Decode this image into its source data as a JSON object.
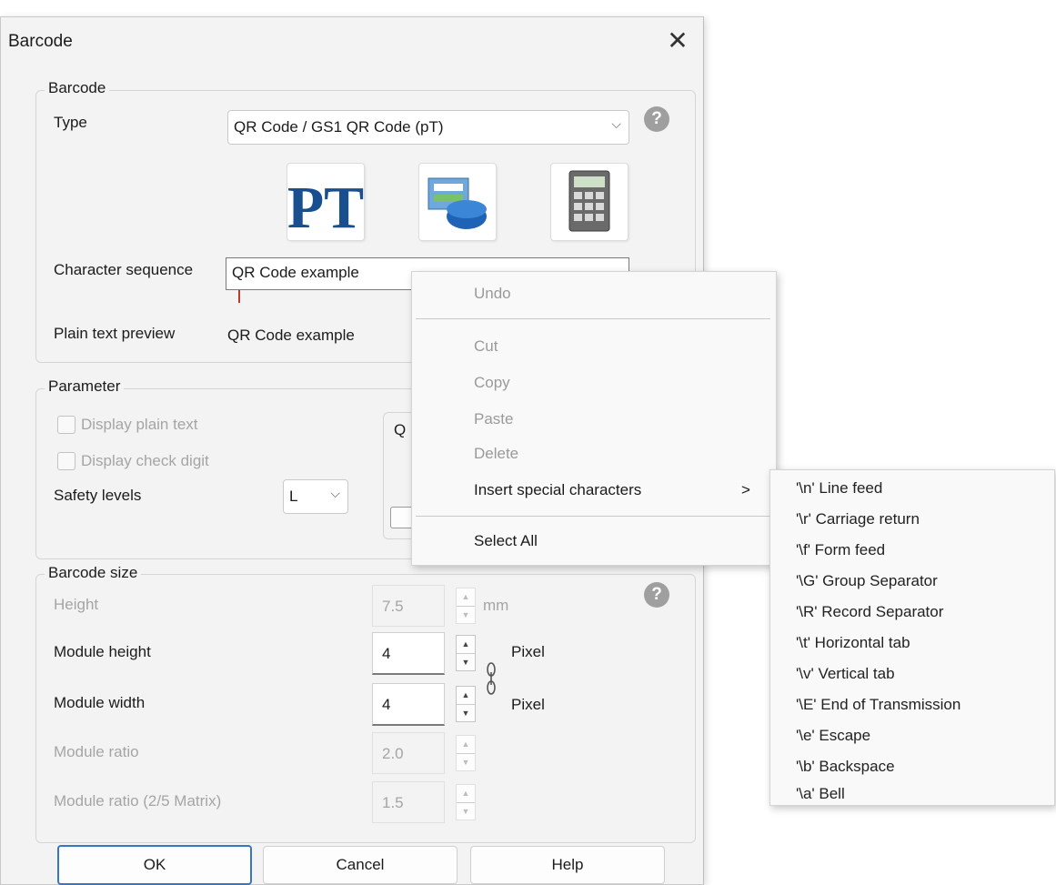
{
  "dialog": {
    "title": "Barcode",
    "close_icon": "close-icon",
    "barcode_group": {
      "legend": "Barcode",
      "type_label": "Type",
      "type_value": "QR Code / GS1 QR Code  (pT)",
      "tiles": [
        "pt-logo-icon",
        "database-icon",
        "calculator-icon"
      ],
      "tile_text": "PT",
      "char_seq_label": "Character sequence",
      "char_seq_value": "QR Code example",
      "preview_label": "Plain text preview",
      "preview_value": "QR Code example"
    },
    "parameter_group": {
      "legend": "Parameter",
      "display_plain_text": "Display plain text",
      "display_check_digit": "Display check digit",
      "safety_levels_label": "Safety levels",
      "safety_levels_value": "L",
      "partial_q": "Q"
    },
    "size_group": {
      "legend": "Barcode size",
      "height_label": "Height",
      "height_value": "7.5",
      "height_unit": "mm",
      "module_height_label": "Module height",
      "module_height_value": "4",
      "module_height_unit": "Pixel",
      "module_width_label": "Module width",
      "module_width_value": "4",
      "module_width_unit": "Pixel",
      "module_ratio_label": "Module ratio",
      "module_ratio_value": "2.0",
      "module_ratio_25_label": "Module ratio (2/5 Matrix)",
      "module_ratio_25_value": "1.5"
    },
    "buttons": {
      "ok": "OK",
      "cancel": "Cancel",
      "help": "Help"
    },
    "help_glyph": "?"
  },
  "context_menu": {
    "undo": "Undo",
    "cut": "Cut",
    "copy": "Copy",
    "paste": "Paste",
    "delete": "Delete",
    "insert_special": "Insert special characters",
    "submenu_arrow": ">",
    "select_all": "Select All"
  },
  "submenu": [
    "'\\n' Line feed",
    "'\\r' Carriage return",
    "'\\f' Form feed",
    "'\\G' Group Separator",
    "'\\R' Record Separator",
    "'\\t' Horizontal tab",
    "'\\v' Vertical tab",
    "'\\E' End of Transmission",
    "'\\e' Escape",
    "'\\b' Backspace",
    "'\\a' Bell"
  ],
  "colors": {
    "accent": "#3a76c0",
    "pt_logo": "#1a4f8f"
  }
}
